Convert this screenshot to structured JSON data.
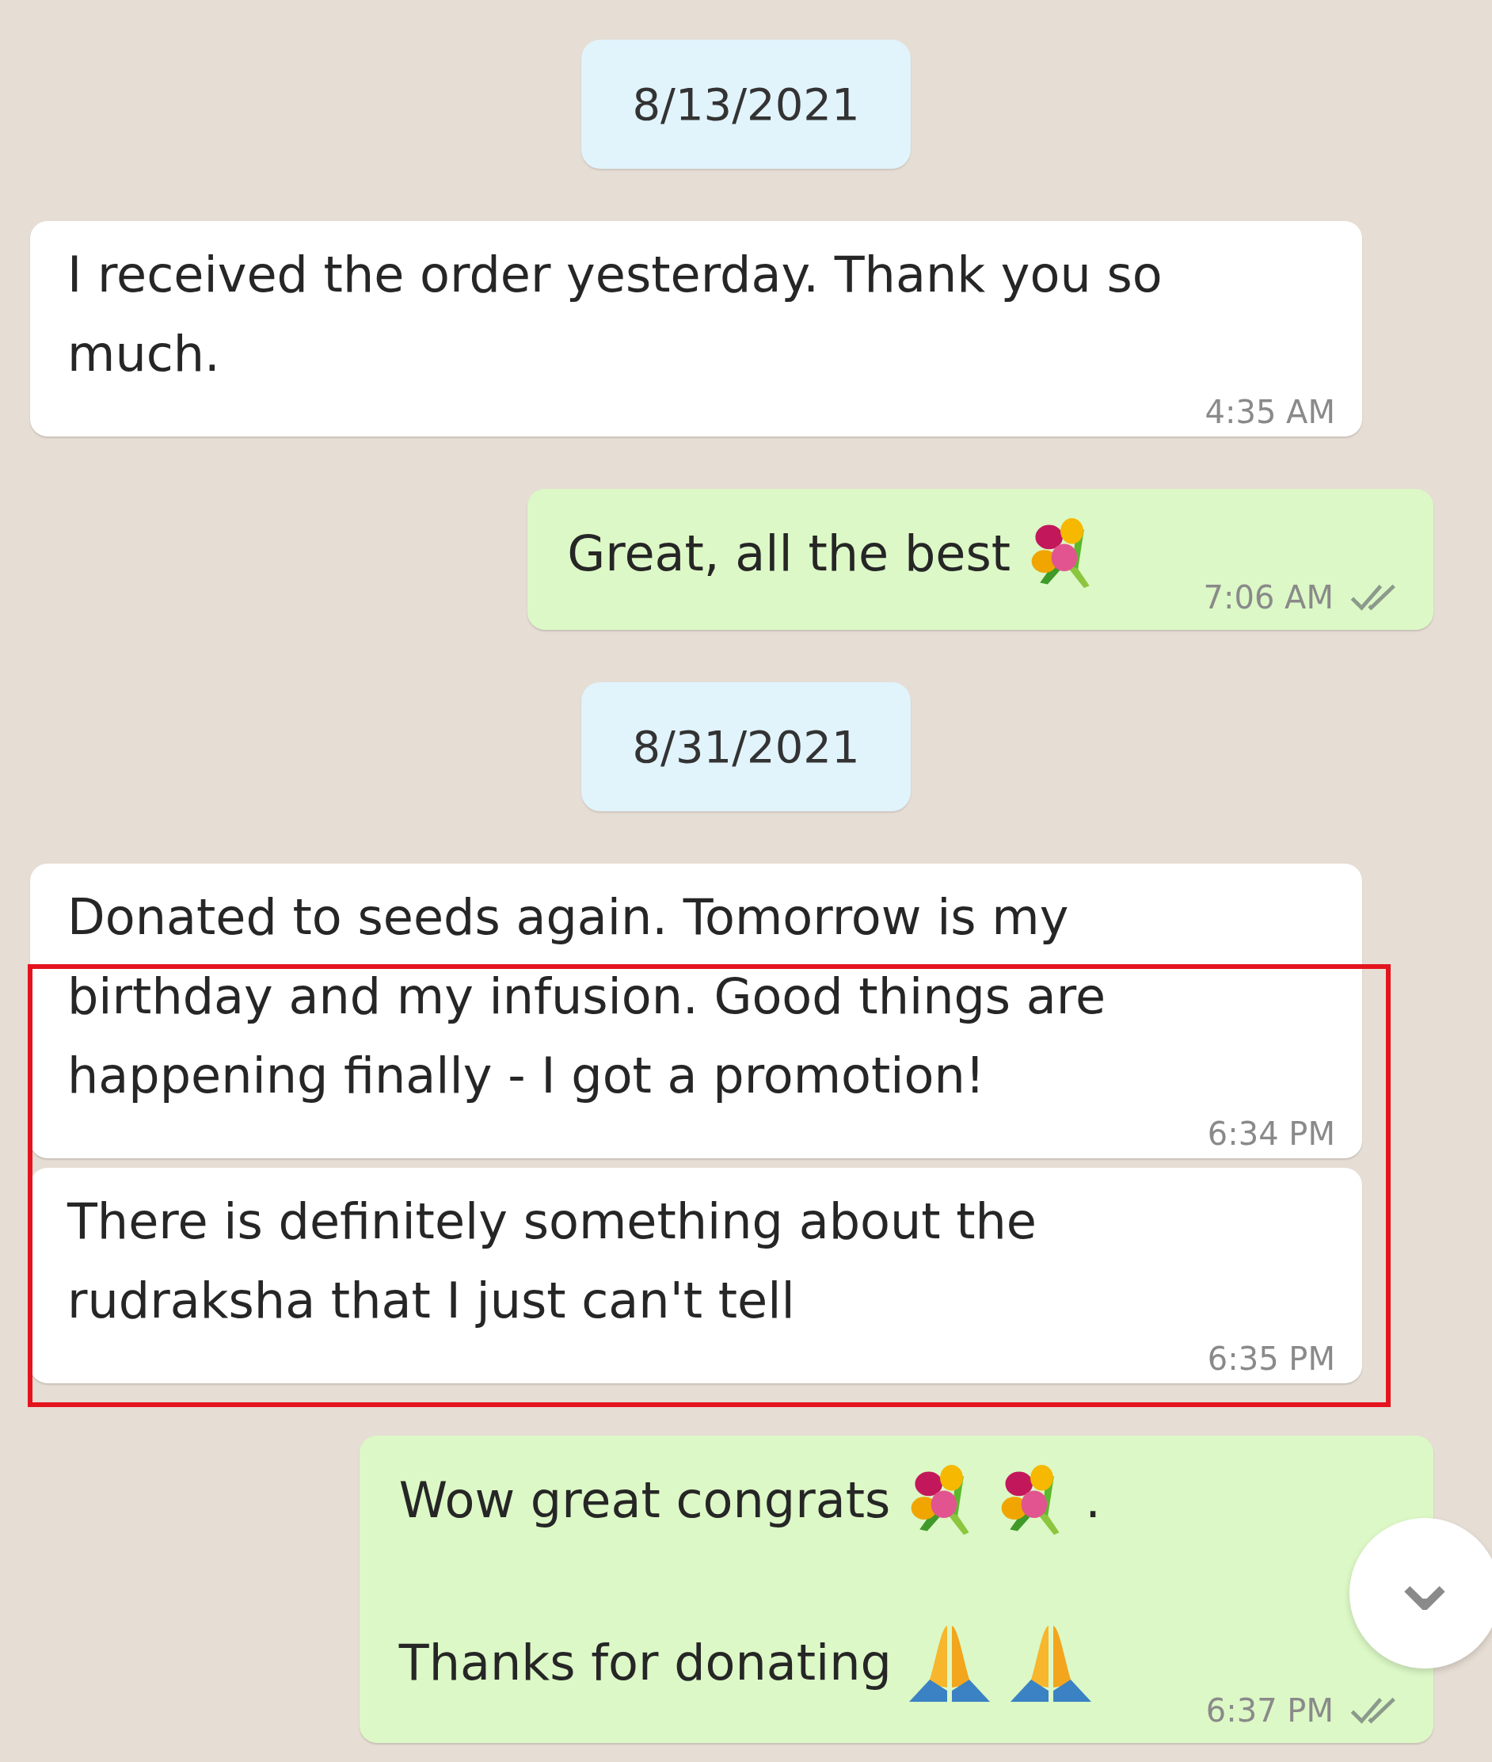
{
  "items": [
    {
      "kind": "date",
      "text": "8/13/2021"
    },
    {
      "kind": "incoming",
      "paragraphs": [
        [
          {
            "kind": "text",
            "text": "I received the order yesterday. Thank you so much."
          }
        ]
      ],
      "time": "4:35 AM"
    },
    {
      "kind": "outgoing",
      "paragraphs": [
        [
          {
            "kind": "text",
            "text": "Great, all the best"
          },
          {
            "kind": "bouquet"
          }
        ]
      ],
      "time": "7:06 AM"
    },
    {
      "kind": "date",
      "text": "8/31/2021"
    },
    {
      "kind": "incoming",
      "paragraphs": [
        [
          {
            "kind": "text",
            "text": "Donated to seeds again. Tomorrow is my birthday and my infusion. Good things are happening finally - I got a promotion!"
          }
        ]
      ],
      "time": "6:34 PM"
    },
    {
      "kind": "incoming",
      "paragraphs": [
        [
          {
            "kind": "text",
            "text": "There is definitely something about the rudraksha that I just can't tell"
          }
        ]
      ],
      "time": "6:35 PM"
    },
    {
      "kind": "outgoing",
      "paragraphs": [
        [
          {
            "kind": "text",
            "text": "Wow great congrats"
          },
          {
            "kind": "bouquet"
          },
          {
            "kind": "bouquet"
          },
          {
            "kind": "text",
            "text": "."
          }
        ],
        [
          {
            "kind": "text",
            "text": "Thanks for donating"
          },
          {
            "kind": "hands"
          },
          {
            "kind": "hands"
          }
        ]
      ],
      "time": "6:37 PM"
    }
  ],
  "highlight": {
    "color": "#e3141e"
  },
  "scroll_button": {
    "glyph": "⌄"
  }
}
